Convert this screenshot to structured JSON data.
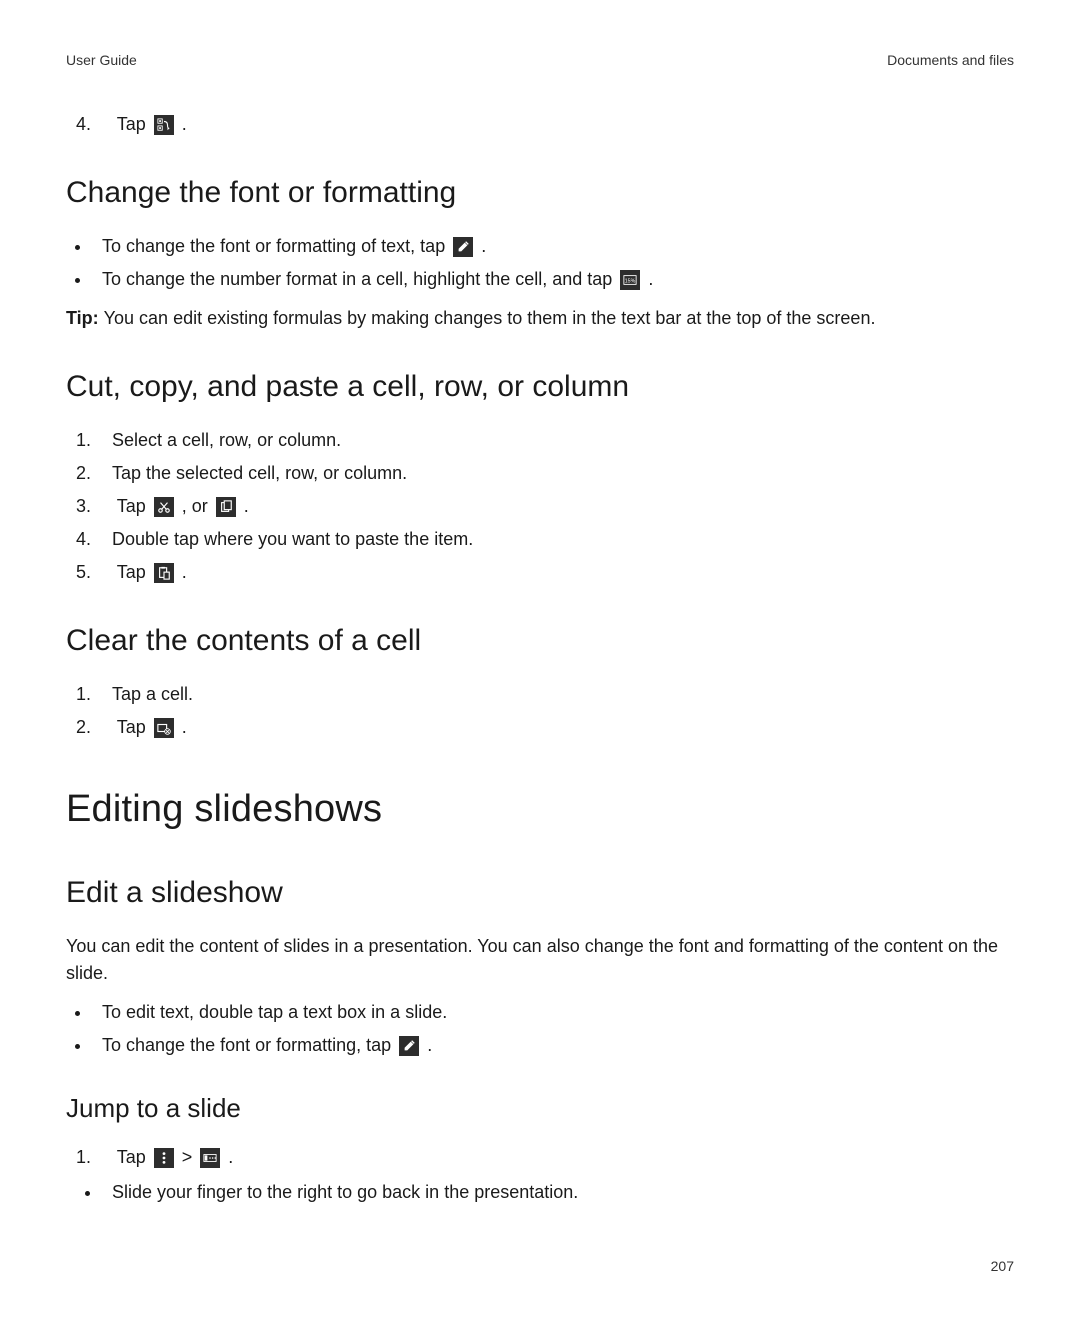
{
  "header": {
    "left": "User Guide",
    "right": "Documents and files"
  },
  "step4": {
    "pre": "Tap ",
    "post": " ."
  },
  "h2_font": "Change the font or formatting",
  "font_bullets": {
    "b1_pre": "To change the font or formatting of text, tap ",
    "b1_post": " .",
    "b2_pre": "To change the number format in a cell, highlight the cell, and tap ",
    "b2_post": " ."
  },
  "tip": {
    "label": "Tip: ",
    "text": "You can edit existing formulas by making changes to them in the text bar at the top of the screen."
  },
  "h2_cut": "Cut, copy, and paste a cell, row, or column",
  "cut_steps": {
    "s1": "Select a cell, row, or column.",
    "s2": "Tap the selected cell, row, or column.",
    "s3_pre": "Tap ",
    "s3_mid": " , or ",
    "s3_post": " .",
    "s4": "Double tap where you want to paste the item.",
    "s5_pre": "Tap ",
    "s5_post": " ."
  },
  "h2_clear": "Clear the contents of a cell",
  "clear_steps": {
    "s1": "Tap a cell.",
    "s2_pre": "Tap ",
    "s2_post": " ."
  },
  "h1_slideshows": "Editing slideshows",
  "h2_edit_slide": "Edit a slideshow",
  "edit_slide_para": "You can edit the content of slides in a presentation. You can also change the font and formatting of the content on the slide.",
  "edit_slide_bullets": {
    "b1": "To edit text, double tap a text box in a slide.",
    "b2_pre": "To change the font or formatting, tap ",
    "b2_post": " ."
  },
  "h3_jump": "Jump to a slide",
  "jump": {
    "s1_pre": "Tap ",
    "s1_arrow": "  >  ",
    "s1_post": " .",
    "sub1": "Slide your finger to the right to go back in the presentation."
  },
  "page_number": "207"
}
